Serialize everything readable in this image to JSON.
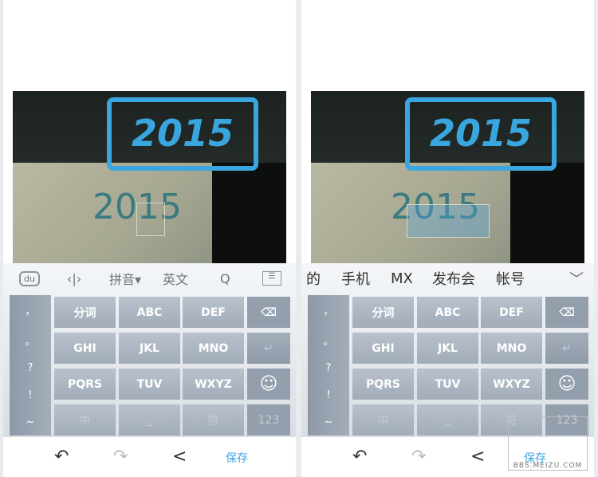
{
  "photo": {
    "handwritten": "2015",
    "recognized": "2015"
  },
  "keyboard": {
    "toolbar": {
      "logo": "du",
      "cursor_icon": "cursor-move-icon",
      "pinyin": "拼音▾",
      "english": "英文",
      "search": "Q",
      "menu_icon": "keyboard-hide-icon"
    },
    "candidates": [
      "的",
      "手机",
      "MX",
      "发布会",
      "帐号"
    ],
    "candidates_expand": "﹀",
    "punct": [
      "，",
      "。",
      "?",
      "!",
      "~"
    ],
    "keys": [
      [
        "分词",
        "ABC",
        "DEF",
        "⌫"
      ],
      [
        "GHI",
        "JKL",
        "MNO",
        "↵"
      ],
      [
        "PQRS",
        "TUV",
        "WXYZ",
        "☺"
      ],
      [
        "中",
        "␣",
        "符",
        "123"
      ]
    ]
  },
  "bottom": {
    "undo": "↶",
    "redo": "↷",
    "share": "<",
    "save": "保存"
  },
  "watermark": "BBS.MEIZU.COM",
  "colors": {
    "accent": "#3aa6e0",
    "key": "#98a3b1"
  }
}
